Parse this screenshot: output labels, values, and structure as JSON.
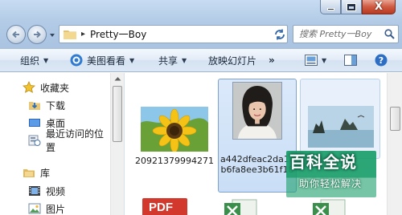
{
  "window": {
    "controls": [
      "minimize",
      "maximize",
      "close"
    ],
    "close_glyph": "X"
  },
  "address_bar": {
    "separator": "▸",
    "path": "Pretty一Boy"
  },
  "search": {
    "placeholder": "搜索 Pretty一Boy"
  },
  "command_bar": {
    "organize": "组织",
    "meitu": "美图看看",
    "share": "共享",
    "slideshow": "放映幻灯片",
    "more": "»"
  },
  "nav_pane": {
    "favorites": "收藏夹",
    "downloads": "下载",
    "desktop": "桌面",
    "recent": "最近访问的位置",
    "libraries": "库",
    "videos": "视频",
    "pictures": "图片"
  },
  "items": [
    {
      "label": "20921379994271"
    },
    {
      "label": "a442dfeac2da1cb6fa8ee3b61f18"
    },
    {
      "label": ""
    },
    {
      "label": "PDF"
    }
  ],
  "watermark": {
    "title": "百科全说",
    "subtitle": "助你轻松解决"
  },
  "colors": {
    "selection": "#c9def6",
    "selection_border": "#7da2ce",
    "pdf_red": "#d3382c",
    "watermark_green": "#1b9e6b"
  }
}
